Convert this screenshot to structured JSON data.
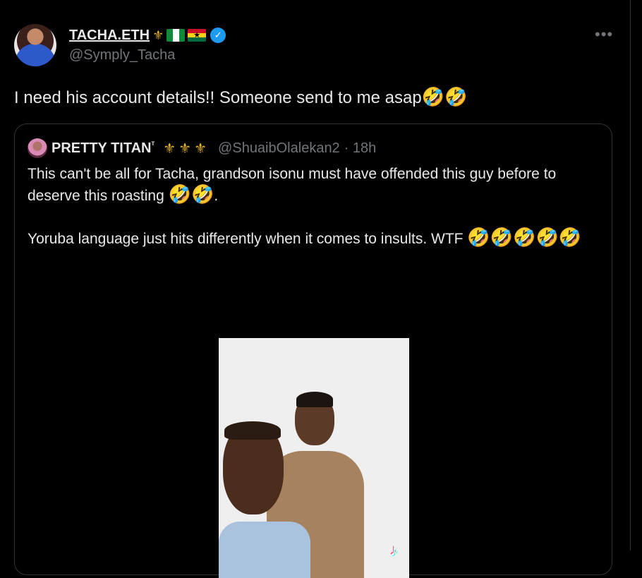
{
  "author": {
    "display_name": "TACHA.ETH",
    "handle": "@Symply_Tacha",
    "name_icons": [
      "gold-trident-icon",
      "nigeria-flag-icon",
      "ghana-flag-icon"
    ],
    "verified": true
  },
  "tweet": {
    "text": "I need his account details!! Someone send to me asap",
    "emojis": "🤣🤣"
  },
  "quote": {
    "display_name": "PRETTY TITAN",
    "name_superscript": "ᵀ",
    "name_icons_text": "⚜⚜⚜",
    "handle": "@ShuaibOlalekan2",
    "time": "· 18h",
    "paragraph1": "This can't be all for Tacha, grandson isonu must have offended this guy before to deserve this roasting",
    "paragraph1_emojis": "🤣🤣",
    "paragraph1_end": ".",
    "paragraph2": "Yoruba language just hits differently when it comes to insults. WTF",
    "paragraph2_emojis": "🤣🤣🤣🤣🤣"
  },
  "icons": {
    "more": "more-options-icon",
    "tiktok": "tiktok-watermark-icon"
  },
  "colors": {
    "background": "#000000",
    "text": "#e7e9ea",
    "muted": "#71767b",
    "border": "#2f3336",
    "verified": "#1d9bf0",
    "gold": "#e0b12b"
  }
}
